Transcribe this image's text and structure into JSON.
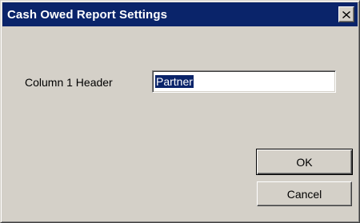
{
  "window": {
    "title": "Cash Owed Report Settings",
    "close_icon": "close-icon"
  },
  "form": {
    "column1_label": "Column 1 Header",
    "column1_value": "Partner"
  },
  "buttons": {
    "ok_label": "OK",
    "cancel_label": "Cancel"
  },
  "colors": {
    "title_bar": "#0a246a",
    "dialog_face": "#d4d0c8",
    "selection": "#0a246a"
  }
}
